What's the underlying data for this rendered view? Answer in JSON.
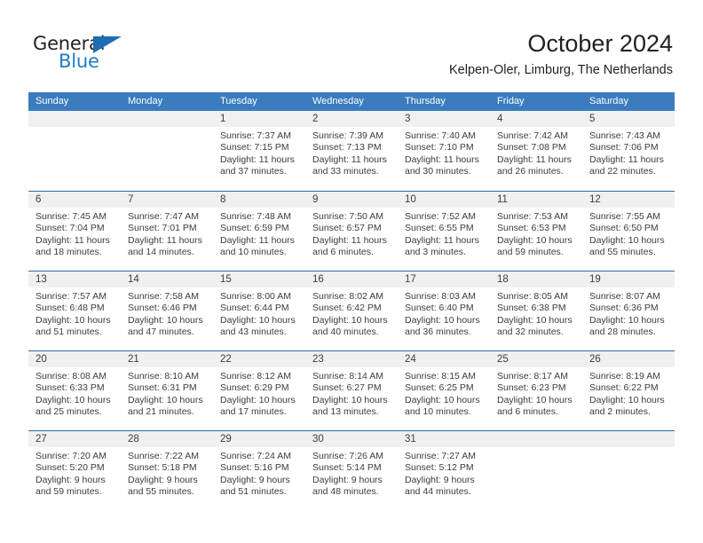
{
  "brand": {
    "name_top": "General",
    "name_bottom": "Blue",
    "accent_color": "#1f7cc4",
    "triangle_color": "#1f6eb5"
  },
  "header": {
    "title": "October 2024",
    "subtitle": "Kelpen-Oler, Limburg, The Netherlands"
  },
  "calendar": {
    "header_bg": "#3a7cbe",
    "row_divider_color": "#2c6ca8",
    "day_band_bg": "#f0f0f0",
    "weekdays": [
      "Sunday",
      "Monday",
      "Tuesday",
      "Wednesday",
      "Thursday",
      "Friday",
      "Saturday"
    ],
    "weeks": [
      [
        {
          "day": "",
          "lines": []
        },
        {
          "day": "",
          "lines": []
        },
        {
          "day": "1",
          "lines": [
            "Sunrise: 7:37 AM",
            "Sunset: 7:15 PM",
            "Daylight: 11 hours",
            "and 37 minutes."
          ]
        },
        {
          "day": "2",
          "lines": [
            "Sunrise: 7:39 AM",
            "Sunset: 7:13 PM",
            "Daylight: 11 hours",
            "and 33 minutes."
          ]
        },
        {
          "day": "3",
          "lines": [
            "Sunrise: 7:40 AM",
            "Sunset: 7:10 PM",
            "Daylight: 11 hours",
            "and 30 minutes."
          ]
        },
        {
          "day": "4",
          "lines": [
            "Sunrise: 7:42 AM",
            "Sunset: 7:08 PM",
            "Daylight: 11 hours",
            "and 26 minutes."
          ]
        },
        {
          "day": "5",
          "lines": [
            "Sunrise: 7:43 AM",
            "Sunset: 7:06 PM",
            "Daylight: 11 hours",
            "and 22 minutes."
          ]
        }
      ],
      [
        {
          "day": "6",
          "lines": [
            "Sunrise: 7:45 AM",
            "Sunset: 7:04 PM",
            "Daylight: 11 hours",
            "and 18 minutes."
          ]
        },
        {
          "day": "7",
          "lines": [
            "Sunrise: 7:47 AM",
            "Sunset: 7:01 PM",
            "Daylight: 11 hours",
            "and 14 minutes."
          ]
        },
        {
          "day": "8",
          "lines": [
            "Sunrise: 7:48 AM",
            "Sunset: 6:59 PM",
            "Daylight: 11 hours",
            "and 10 minutes."
          ]
        },
        {
          "day": "9",
          "lines": [
            "Sunrise: 7:50 AM",
            "Sunset: 6:57 PM",
            "Daylight: 11 hours",
            "and 6 minutes."
          ]
        },
        {
          "day": "10",
          "lines": [
            "Sunrise: 7:52 AM",
            "Sunset: 6:55 PM",
            "Daylight: 11 hours",
            "and 3 minutes."
          ]
        },
        {
          "day": "11",
          "lines": [
            "Sunrise: 7:53 AM",
            "Sunset: 6:53 PM",
            "Daylight: 10 hours",
            "and 59 minutes."
          ]
        },
        {
          "day": "12",
          "lines": [
            "Sunrise: 7:55 AM",
            "Sunset: 6:50 PM",
            "Daylight: 10 hours",
            "and 55 minutes."
          ]
        }
      ],
      [
        {
          "day": "13",
          "lines": [
            "Sunrise: 7:57 AM",
            "Sunset: 6:48 PM",
            "Daylight: 10 hours",
            "and 51 minutes."
          ]
        },
        {
          "day": "14",
          "lines": [
            "Sunrise: 7:58 AM",
            "Sunset: 6:46 PM",
            "Daylight: 10 hours",
            "and 47 minutes."
          ]
        },
        {
          "day": "15",
          "lines": [
            "Sunrise: 8:00 AM",
            "Sunset: 6:44 PM",
            "Daylight: 10 hours",
            "and 43 minutes."
          ]
        },
        {
          "day": "16",
          "lines": [
            "Sunrise: 8:02 AM",
            "Sunset: 6:42 PM",
            "Daylight: 10 hours",
            "and 40 minutes."
          ]
        },
        {
          "day": "17",
          "lines": [
            "Sunrise: 8:03 AM",
            "Sunset: 6:40 PM",
            "Daylight: 10 hours",
            "and 36 minutes."
          ]
        },
        {
          "day": "18",
          "lines": [
            "Sunrise: 8:05 AM",
            "Sunset: 6:38 PM",
            "Daylight: 10 hours",
            "and 32 minutes."
          ]
        },
        {
          "day": "19",
          "lines": [
            "Sunrise: 8:07 AM",
            "Sunset: 6:36 PM",
            "Daylight: 10 hours",
            "and 28 minutes."
          ]
        }
      ],
      [
        {
          "day": "20",
          "lines": [
            "Sunrise: 8:08 AM",
            "Sunset: 6:33 PM",
            "Daylight: 10 hours",
            "and 25 minutes."
          ]
        },
        {
          "day": "21",
          "lines": [
            "Sunrise: 8:10 AM",
            "Sunset: 6:31 PM",
            "Daylight: 10 hours",
            "and 21 minutes."
          ]
        },
        {
          "day": "22",
          "lines": [
            "Sunrise: 8:12 AM",
            "Sunset: 6:29 PM",
            "Daylight: 10 hours",
            "and 17 minutes."
          ]
        },
        {
          "day": "23",
          "lines": [
            "Sunrise: 8:14 AM",
            "Sunset: 6:27 PM",
            "Daylight: 10 hours",
            "and 13 minutes."
          ]
        },
        {
          "day": "24",
          "lines": [
            "Sunrise: 8:15 AM",
            "Sunset: 6:25 PM",
            "Daylight: 10 hours",
            "and 10 minutes."
          ]
        },
        {
          "day": "25",
          "lines": [
            "Sunrise: 8:17 AM",
            "Sunset: 6:23 PM",
            "Daylight: 10 hours",
            "and 6 minutes."
          ]
        },
        {
          "day": "26",
          "lines": [
            "Sunrise: 8:19 AM",
            "Sunset: 6:22 PM",
            "Daylight: 10 hours",
            "and 2 minutes."
          ]
        }
      ],
      [
        {
          "day": "27",
          "lines": [
            "Sunrise: 7:20 AM",
            "Sunset: 5:20 PM",
            "Daylight: 9 hours",
            "and 59 minutes."
          ]
        },
        {
          "day": "28",
          "lines": [
            "Sunrise: 7:22 AM",
            "Sunset: 5:18 PM",
            "Daylight: 9 hours",
            "and 55 minutes."
          ]
        },
        {
          "day": "29",
          "lines": [
            "Sunrise: 7:24 AM",
            "Sunset: 5:16 PM",
            "Daylight: 9 hours",
            "and 51 minutes."
          ]
        },
        {
          "day": "30",
          "lines": [
            "Sunrise: 7:26 AM",
            "Sunset: 5:14 PM",
            "Daylight: 9 hours",
            "and 48 minutes."
          ]
        },
        {
          "day": "31",
          "lines": [
            "Sunrise: 7:27 AM",
            "Sunset: 5:12 PM",
            "Daylight: 9 hours",
            "and 44 minutes."
          ]
        },
        {
          "day": "",
          "lines": []
        },
        {
          "day": "",
          "lines": []
        }
      ]
    ]
  }
}
